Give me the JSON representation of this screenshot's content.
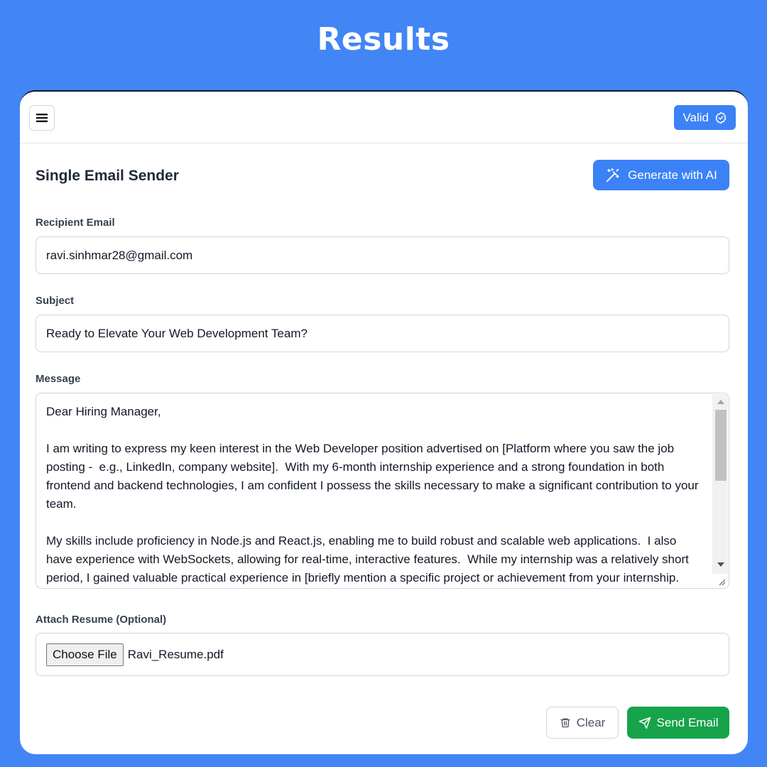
{
  "page": {
    "heading": "Results"
  },
  "topbar": {
    "valid_label": "Valid"
  },
  "form": {
    "title": "Single Email Sender",
    "generate_label": "Generate with AI",
    "recipient": {
      "label": "Recipient Email",
      "value": "ravi.sinhmar28@gmail.com"
    },
    "subject": {
      "label": "Subject",
      "value": "Ready to Elevate Your Web Development Team?"
    },
    "message": {
      "label": "Message",
      "value": "Dear Hiring Manager,\n\nI am writing to express my keen interest in the Web Developer position advertised on [Platform where you saw the job posting -  e.g., LinkedIn, company website].  With my 6-month internship experience and a strong foundation in both frontend and backend technologies, I am confident I possess the skills necessary to make a significant contribution to your team.\n\nMy skills include proficiency in Node.js and React.js, enabling me to build robust and scalable web applications.  I also have experience with WebSockets, allowing for real-time, interactive features.  While my internship was a relatively short period, I gained valuable practical experience in [briefly mention a specific project or achievement from your internship."
    },
    "attachment": {
      "label": "Attach Resume (Optional)",
      "button_label": "Choose File",
      "file_name": "Ravi_Resume.pdf"
    },
    "clear_label": "Clear",
    "send_label": "Send Email"
  },
  "colors": {
    "background": "#4285f4",
    "primary": "#3b82f6",
    "success": "#16a34a"
  },
  "icons": [
    "menu-icon",
    "badge-check-icon",
    "magic-wand-icon",
    "trash-icon",
    "send-icon"
  ]
}
